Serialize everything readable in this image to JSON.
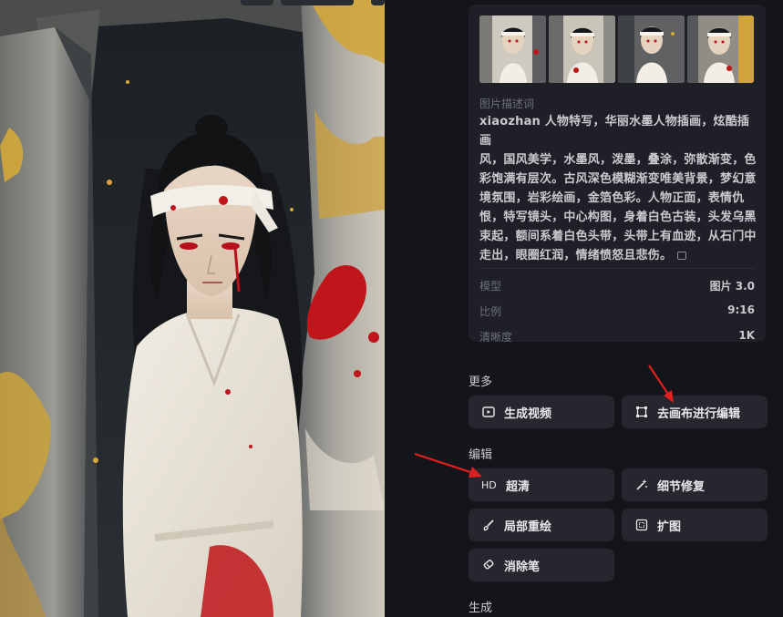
{
  "panel": {
    "description_label": "图片描述词",
    "description_lines": [
      "xiaozhan 人物特写，华丽水墨人物插画，炫酷插画",
      "风，国风美学，水墨风，泼墨，叠涂，弥散渐变，色",
      "彩饱满有层次。古风深色模糊渐变唯美背景，梦幻意",
      "境氛围，岩彩绘画，金箔色彩。人物正面，表情仇",
      "恨，特写镜头，中心构图，身着白色古装，头发乌黑",
      "束起，额间系着白色头带，头带上有血迹，从石门中",
      "走出，眼圈红润，情绪愤怒且悲伤。"
    ],
    "meta": [
      {
        "key": "模型",
        "value": "图片 3.0"
      },
      {
        "key": "比例",
        "value": "9:16"
      },
      {
        "key": "清晰度",
        "value": "1K"
      }
    ]
  },
  "sections": {
    "more": "更多",
    "edit": "编辑",
    "generate": "生成"
  },
  "buttons": {
    "generate_video": "生成视频",
    "canvas_edit": "去画布进行编辑",
    "upscale_badge": "HD",
    "upscale": "超清",
    "detail_fix": "细节修复",
    "inpaint": "局部重绘",
    "outpaint": "扩图",
    "eraser": "消除笔"
  },
  "colors": {
    "background": "#14151a",
    "panel": "#1f2027",
    "button": "#25262e",
    "arrow": "#e0201f",
    "blood": "#c0151a",
    "gold": "#d4a93a"
  }
}
